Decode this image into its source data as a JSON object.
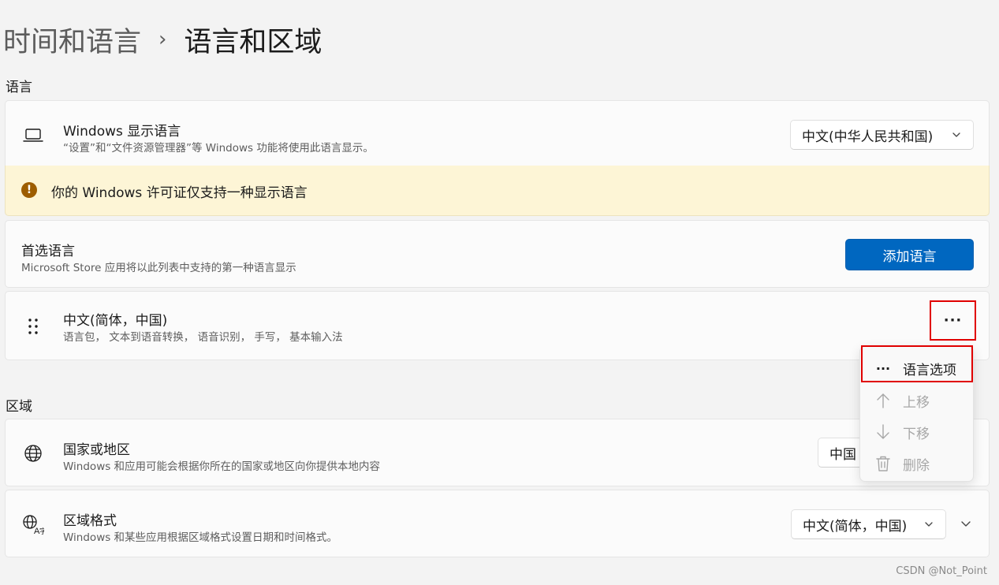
{
  "breadcrumb": {
    "parent": "时间和语言",
    "separator": "›",
    "current": "语言和区域"
  },
  "language_section": {
    "label": "语言",
    "display_language": {
      "icon": "laptop-icon",
      "title": "Windows 显示语言",
      "description": "“设置”和“文件资源管理器”等 Windows 功能将使用此语言显示。",
      "selected": "中文(中华人民共和国)"
    },
    "warning": {
      "icon": "warning-icon",
      "text": "你的 Windows 许可证仅支持一种显示语言"
    },
    "preferred": {
      "title": "首选语言",
      "description": "Microsoft Store 应用将以此列表中支持的第一种语言显示",
      "add_label": "添加语言"
    },
    "language_item": {
      "icon": "drag-handle-icon",
      "title": "中文(简体，中国)",
      "description": "语言包， 文本到语音转换， 语音识别， 手写， 基本输入法",
      "more_label": "···"
    }
  },
  "context_menu": {
    "items": [
      {
        "icon": "more-icon",
        "label": "语言选项",
        "enabled": true
      },
      {
        "icon": "arrow-up-icon",
        "label": "上移",
        "enabled": false
      },
      {
        "icon": "arrow-down-icon",
        "label": "下移",
        "enabled": false
      },
      {
        "icon": "trash-icon",
        "label": "删除",
        "enabled": false
      }
    ]
  },
  "region_section": {
    "label": "区域",
    "country": {
      "icon": "globe-icon",
      "title": "国家或地区",
      "description": "Windows 和应用可能会根据你所在的国家或地区向你提供本地内容",
      "selected": "中国"
    },
    "format": {
      "icon": "language-format-icon",
      "title": "区域格式",
      "description": "Windows 和某些应用根据区域格式设置日期和时间格式。",
      "selected": "中文(简体，中国)"
    }
  },
  "watermark": "CSDN @Not_Point",
  "colors": {
    "accent": "#0067c0",
    "warning_bg": "#fdf5d6",
    "highlight": "#e00000"
  }
}
